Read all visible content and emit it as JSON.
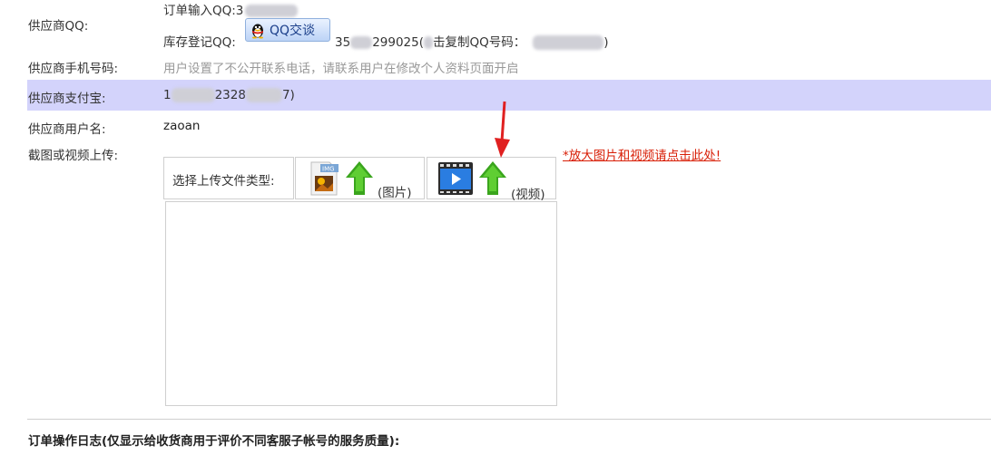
{
  "qq": {
    "label": "供应商QQ:",
    "order_input_prefix": "订单输入QQ:3",
    "stock_prefix": "库存登记QQ:",
    "stock_value_partial": "35",
    "stock_value_tail": "299025(",
    "copy_text": "击复制QQ号码：",
    "copy_close": ")",
    "chat_button": "QQ交谈"
  },
  "phone": {
    "label": "供应商手机号码:",
    "value": "用户设置了不公开联系电话，请联系用户在修改个人资料页面开启"
  },
  "alipay": {
    "label": "供应商支付宝:",
    "value_start": "1",
    "value_mid": "2328",
    "value_end": "7)"
  },
  "username": {
    "label": "供应商用户名:",
    "value": "zaoan"
  },
  "upload": {
    "label": "截图或视频上传:",
    "type_label": "选择上传文件类型:",
    "image_option": "(图片)",
    "video_option": "(视频)",
    "enlarge_link": "*放大图片和视频请点击此处!"
  },
  "log": {
    "title": "订单操作日志(仅显示给收货商用于评价不同客服子帐号的服务质量):"
  },
  "colors": {
    "highlight_row": "#d3d3fb",
    "link_red": "#d81e06",
    "arrow_green": "#3aa51d",
    "annotation_red": "#e02020"
  },
  "icons": {
    "qq": "qq-penguin-icon",
    "image_type": "image-file-icon",
    "video_type": "video-file-icon",
    "upload": "upload-arrow-icon"
  }
}
